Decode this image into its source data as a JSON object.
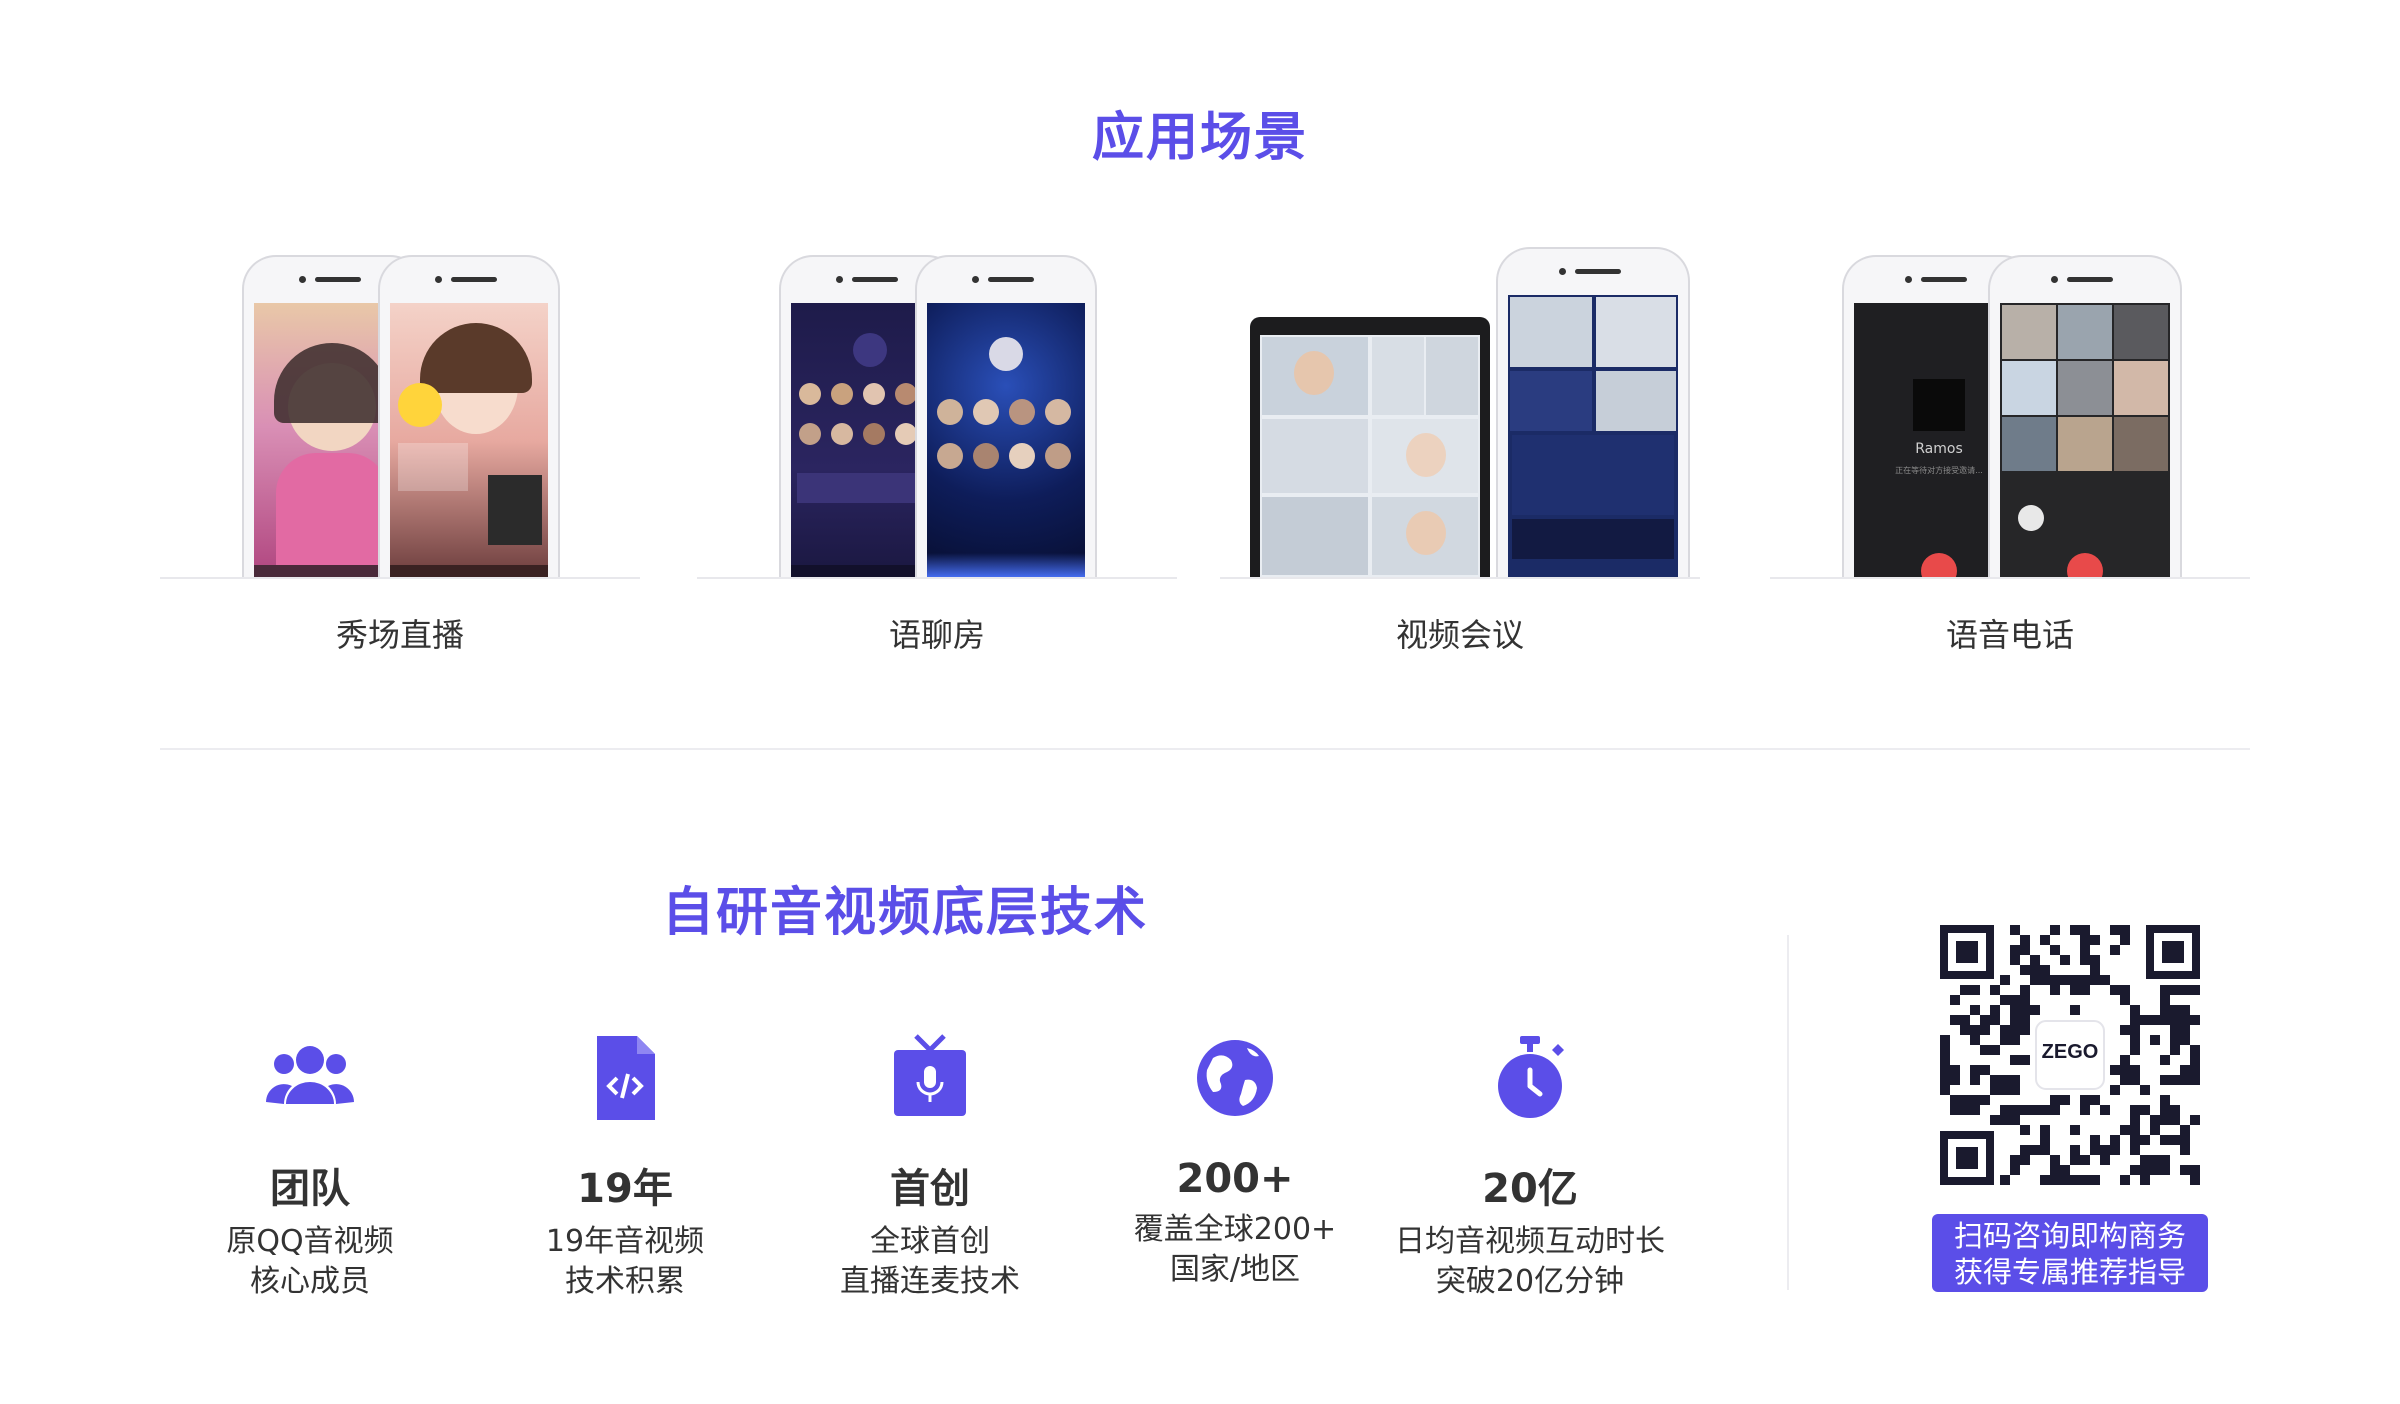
{
  "scenes_section": {
    "title": "应用场景",
    "items": [
      {
        "label": "秀场直播"
      },
      {
        "label": "语聊房"
      },
      {
        "label": "视频会议"
      },
      {
        "label": "语音电话"
      }
    ],
    "screen_texts": {
      "call_name": "Ramos",
      "call_status": "正在等待对方接受邀请..."
    }
  },
  "tech_section": {
    "title": "自研音视频底层技术",
    "features": [
      {
        "icon": "team-icon",
        "value": "团队",
        "line1": "原QQ音视频",
        "line2": "核心成员"
      },
      {
        "icon": "code-file-icon",
        "value": "19年",
        "line1": "19年音视频",
        "line2": "技术积累"
      },
      {
        "icon": "tv-mic-icon",
        "value": "首创",
        "line1": "全球首创",
        "line2": "直播连麦技术"
      },
      {
        "icon": "globe-icon",
        "value": "200+",
        "line1": "覆盖全球200+",
        "line2": "国家/地区"
      },
      {
        "icon": "stopwatch-icon",
        "value": "20亿",
        "line1": "日均音视频互动时长",
        "line2": "突破20亿分钟"
      }
    ]
  },
  "qr": {
    "logo_text": "ZEGO",
    "caption_line1": "扫码咨询即构商务",
    "caption_line2": "获得专属推荐指导"
  },
  "colors": {
    "accent": "#5b4ee8",
    "text": "#333333",
    "divider": "#ececf0"
  }
}
